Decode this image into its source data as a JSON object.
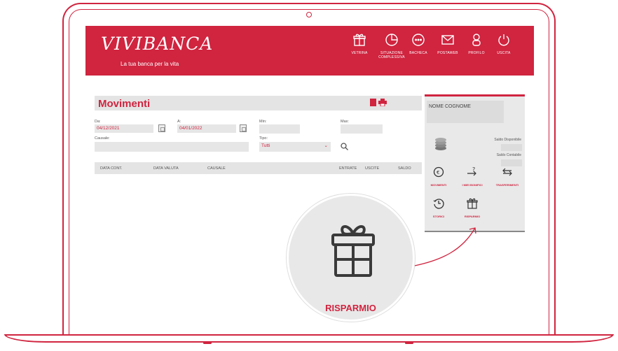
{
  "brand": {
    "logo": "VIVIBANCA",
    "tagline": "La tua banca per la vita",
    "color": "#d0243f"
  },
  "nav": [
    {
      "label": "VETRINA",
      "icon": "gift-icon"
    },
    {
      "label": "SITUAZIONE COMPLESSIVA",
      "icon": "pie-chart-icon"
    },
    {
      "label": "BACHECA",
      "icon": "chat-icon"
    },
    {
      "label": "POSTAWEB",
      "icon": "envelope-icon"
    },
    {
      "label": "PROFILO",
      "icon": "user-icon"
    },
    {
      "label": "USCITA",
      "icon": "power-icon"
    }
  ],
  "movimenti": {
    "title": "Movimenti",
    "filters": {
      "da_label": "Da:",
      "da_value": "04/12/2021",
      "a_label": "A:",
      "a_value": "04/01/2022",
      "min_label": "Min:",
      "max_label": "Max:",
      "causale_label": "Causale:",
      "tipo_label": "Tipo:",
      "tipo_value": "Tutti"
    },
    "columns": [
      "DATA CONT.",
      "DATA VALUTA",
      "CAUSALE",
      "ENTRATE",
      "USCITE",
      "SALDO"
    ]
  },
  "account": {
    "name": "NOME COGNOME",
    "saldo_disponibile_label": "Saldo Disponibile",
    "saldo_contabile_label": "Saldo Contabile",
    "actions": [
      {
        "label": "MOVIMENTI",
        "icon": "euro-history-icon"
      },
      {
        "label": "I MIEI BONIFICI",
        "icon": "transfer-question-icon"
      },
      {
        "label": "TRASFERIMENTI",
        "icon": "transfer-icon"
      },
      {
        "label": "STORICI",
        "icon": "history-icon"
      },
      {
        "label": "RISPARMIO",
        "icon": "gift-icon"
      }
    ]
  },
  "callout": {
    "label": "RISPARMIO",
    "icon": "gift-icon"
  }
}
